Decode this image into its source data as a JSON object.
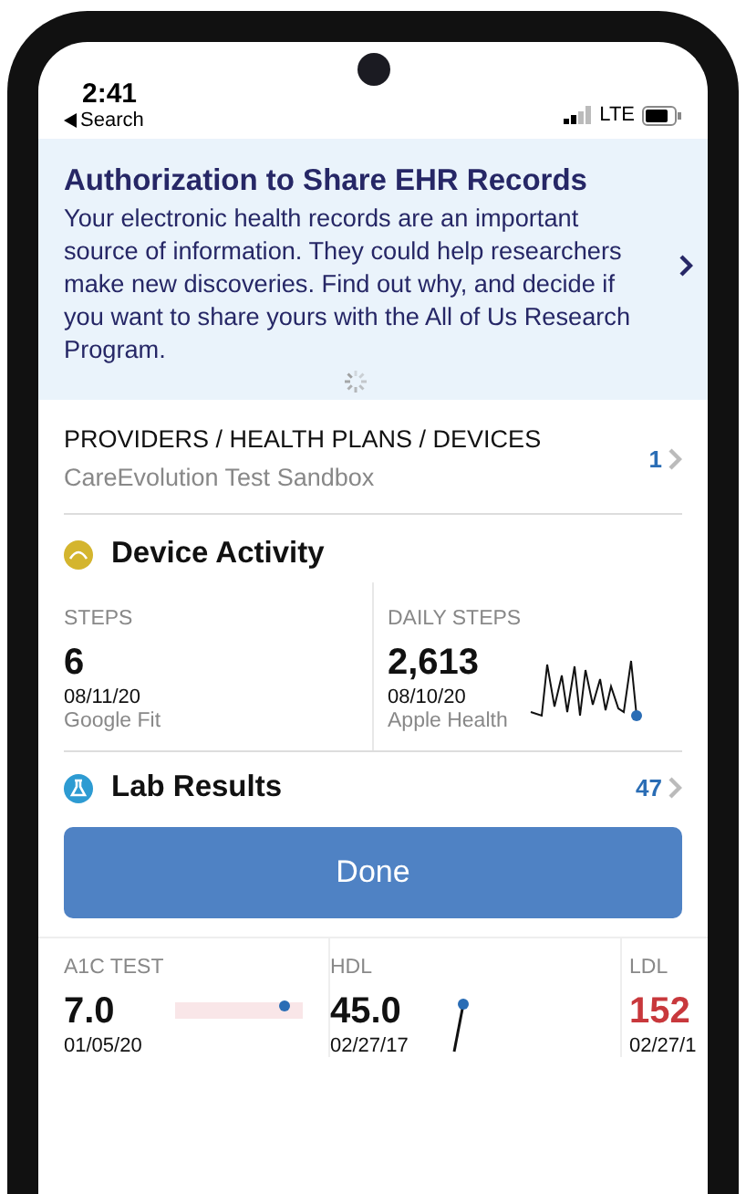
{
  "status_bar": {
    "time": "2:41",
    "back_label": "Search",
    "network": "LTE"
  },
  "banner": {
    "title": "Authorization to Share EHR Records",
    "body": "Your electronic health records are an important source of information. They could help researchers make new discoveries. Find out why, and decide if you want to share yours with the All of Us Research Program."
  },
  "providers": {
    "title": "PROVIDERS / HEALTH PLANS / DEVICES",
    "subtitle": "CareEvolution Test Sandbox",
    "count": "1"
  },
  "device_activity": {
    "title": "Device Activity",
    "metrics": [
      {
        "kind": "plain",
        "label": "STEPS",
        "value": "6",
        "date": "08/11/20",
        "source": "Google Fit"
      },
      {
        "kind": "sparkline",
        "label": "DAILY STEPS",
        "value": "2,613",
        "date": "08/10/20",
        "source": "Apple Health"
      }
    ]
  },
  "lab_results": {
    "title": "Lab Results",
    "count": "47"
  },
  "done_button": {
    "label": "Done"
  },
  "lab_tests": [
    {
      "kind": "range",
      "name": "A1C TEST",
      "value": "7.0",
      "date": "01/05/20",
      "abnormal": false
    },
    {
      "kind": "trend",
      "name": "HDL",
      "value": "45.0",
      "date": "02/27/17",
      "abnormal": false
    },
    {
      "kind": "none",
      "name": "LDL",
      "value": "152",
      "date": "02/27/1",
      "abnormal": true
    }
  ]
}
